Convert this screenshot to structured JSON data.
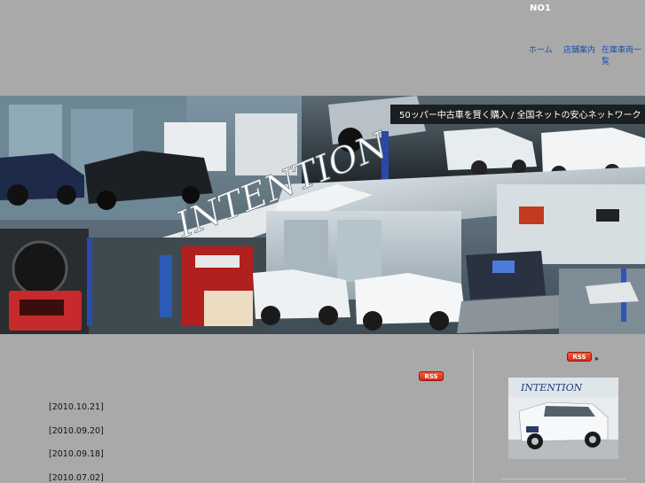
{
  "header": {
    "site_name": "NO1"
  },
  "nav": {
    "items": [
      {
        "label": "ホーム"
      },
      {
        "label": "店舗案内"
      },
      {
        "label": "在庫車両一覧"
      }
    ]
  },
  "banner": {
    "tagline": "50ッパー中古車を賢く購入 / 全国ネットの安心ネットワーク",
    "brand": "INTENTION"
  },
  "main": {
    "rss_label": "RSS",
    "news": [
      {
        "date": "[2010.10.21]"
      },
      {
        "date": "[2010.09.20]"
      },
      {
        "date": "[2010.09.18]"
      },
      {
        "date": "[2010.07.02]"
      }
    ]
  },
  "sidebar": {
    "rss_label": "RSS",
    "thumb_brand": "INTENTION"
  }
}
